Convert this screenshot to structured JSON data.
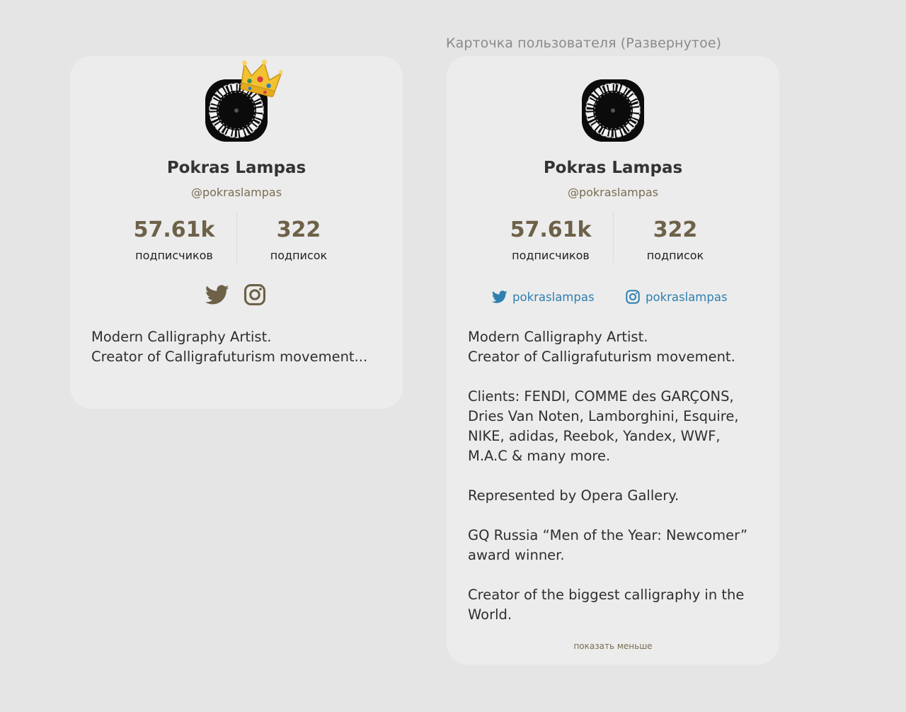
{
  "frame_label": "Карточка пользователя (Развернутое)",
  "profile": {
    "name": "Pokras Lampas",
    "handle": "@pokraslampas",
    "followers_value": "57.61k",
    "followers_label": "подписчиков",
    "following_value": "322",
    "following_label": "подписок",
    "twitter_username": "pokraslampas",
    "instagram_username": "pokraslampas"
  },
  "collapsed_bio": [
    "Modern Calligraphy Artist.",
    "Creator of Calligrafuturism movement..."
  ],
  "expanded_bio": {
    "p1": [
      "Modern Calligraphy Artist.",
      "Creator of Calligrafuturism movement."
    ],
    "p2": [
      "Clients: FENDI, COMME des GARÇONS,",
      "Dries Van Noten, Lamborghini, Esquire,",
      "NIKE, adidas, Reebok, Yandex, WWF,",
      "M.A.C & many more."
    ],
    "p3": [
      "Represented by Opera Gallery."
    ],
    "p4": [
      "GQ Russia “Men of the Year: Newcomer”",
      "award winner."
    ],
    "p5": [
      "Creator of the biggest calligraphy in the",
      "World."
    ]
  },
  "show_less_label": "показать меньше",
  "colors": {
    "background": "#e5e5e5",
    "card": "#ececec",
    "stat_accent": "#6d6148",
    "handle": "#7a6c52",
    "link": "#2f7fb0"
  },
  "icons": [
    "crown-icon",
    "twitter-icon",
    "instagram-icon"
  ]
}
